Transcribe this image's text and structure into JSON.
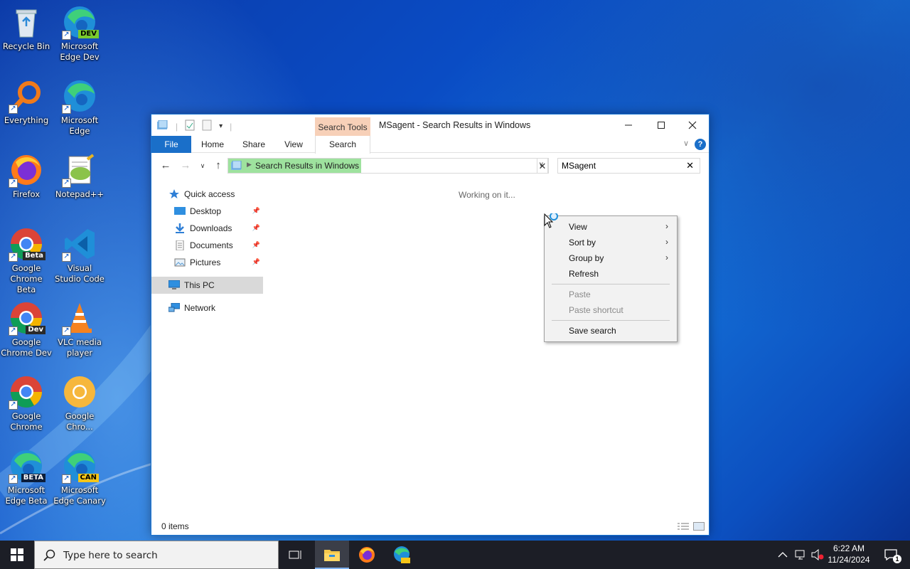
{
  "desktop": {
    "icons": [
      {
        "label": "Recycle Bin"
      },
      {
        "label": "Microsoft Edge Dev",
        "badge": "DEV"
      },
      {
        "label": "Everything"
      },
      {
        "label": "Microsoft Edge"
      },
      {
        "label": "Firefox"
      },
      {
        "label": "Notepad++"
      },
      {
        "label": "Google Chrome Beta",
        "badge": "Beta"
      },
      {
        "label": "Visual Studio Code"
      },
      {
        "label": "Google Chrome Dev",
        "badge": "Dev"
      },
      {
        "label": "VLC media player"
      },
      {
        "label": "Google Chrome"
      },
      {
        "label": "Google Chro..."
      },
      {
        "label": "Microsoft Edge Beta",
        "badge": "BETA"
      },
      {
        "label": "Microsoft Edge Canary",
        "badge": "CAN"
      }
    ]
  },
  "window": {
    "title": "MSagent - Search Results in Windows",
    "context_tab": "Search Tools",
    "tabs": {
      "file": "File",
      "home": "Home",
      "share": "Share",
      "view": "View",
      "search": "Search"
    },
    "address": "Search Results in Windows",
    "search_value": "MSagent",
    "status_text": "Working on it...",
    "item_count": "0 items",
    "nav": {
      "quick_access": "Quick access",
      "desktop": "Desktop",
      "downloads": "Downloads",
      "documents": "Documents",
      "pictures": "Pictures",
      "this_pc": "This PC",
      "network": "Network"
    }
  },
  "context_menu": {
    "view": "View",
    "sort_by": "Sort by",
    "group_by": "Group by",
    "refresh": "Refresh",
    "paste": "Paste",
    "paste_shortcut": "Paste shortcut",
    "save_search": "Save search"
  },
  "taskbar": {
    "search_placeholder": "Type here to search",
    "time": "6:22 AM",
    "date": "11/24/2024",
    "notification_count": "1"
  },
  "colors": {
    "accent": "#1a6fc9",
    "search_tools_tab": "#f7d0b8",
    "address_progress": "#9ee29e",
    "taskbar": "#1c1e26"
  }
}
